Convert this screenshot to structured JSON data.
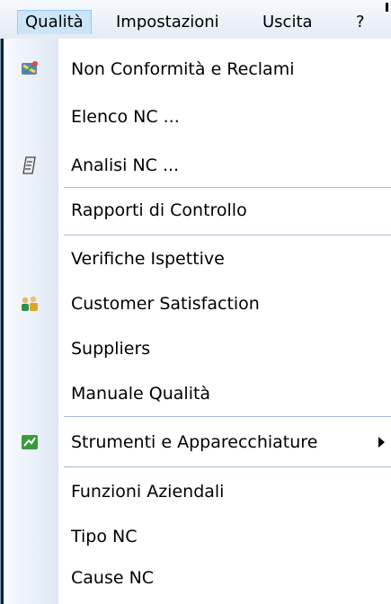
{
  "menubar": {
    "items": [
      {
        "label": "Qualità"
      },
      {
        "label": "Impostazioni"
      },
      {
        "label": "Uscita"
      },
      {
        "label": "?"
      }
    ]
  },
  "menu": {
    "items": [
      {
        "label": "Non Conformità e Reclami",
        "icon": "nc-reclami-icon"
      },
      {
        "label": "Elenco NC ..."
      },
      {
        "label": "Analisi NC ...",
        "icon": "analisi-icon"
      },
      {
        "label": "Rapporti di Controllo"
      },
      {
        "label": "Verifiche Ispettive"
      },
      {
        "label": "Customer Satisfaction",
        "icon": "customers-icon"
      },
      {
        "label": "Suppliers"
      },
      {
        "label": "Manuale Qualità"
      },
      {
        "label": "Strumenti e Apparecchiature",
        "icon": "strumenti-icon",
        "submenu": true
      },
      {
        "label": "Funzioni Aziendali"
      },
      {
        "label": "Tipo NC"
      },
      {
        "label": "Cause NC"
      }
    ]
  },
  "colors": {
    "menubar_bg": "#e3ebf6",
    "active_highlight": "#cce4f7",
    "separator": "#a9b8d8"
  }
}
